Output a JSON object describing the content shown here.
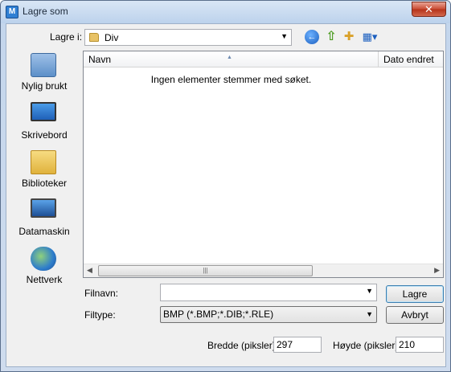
{
  "window": {
    "title": "Lagre som",
    "app_icon_letter": "M",
    "close_symbol": "✕"
  },
  "location": {
    "label": "Lagre i:",
    "value": "Div"
  },
  "toolbar": {
    "back_symbol": "←",
    "up_symbol": "⇧",
    "newfolder_symbol": "✚",
    "views_symbol": "▦▾"
  },
  "places": [
    {
      "label": "Nylig brukt",
      "icon": "recent-places-icon"
    },
    {
      "label": "Skrivebord",
      "icon": "desktop-icon"
    },
    {
      "label": "Biblioteker",
      "icon": "libraries-icon"
    },
    {
      "label": "Datamaskin",
      "icon": "computer-icon"
    },
    {
      "label": "Nettverk",
      "icon": "network-icon"
    }
  ],
  "filelist": {
    "columns": [
      "Navn",
      "Dato endret"
    ],
    "empty_message": "Ingen elementer stemmer med søket."
  },
  "form": {
    "filename_label": "Filnavn:",
    "filename_value": "",
    "filetype_label": "Filtype:",
    "filetype_value": "BMP (*.BMP;*.DIB;*.RLE)",
    "save_button": "Lagre",
    "cancel_button": "Avbryt",
    "width_label": "Bredde (piksler)",
    "width_value": "297",
    "height_label": "Høyde (piksler)",
    "height_value": "210"
  }
}
